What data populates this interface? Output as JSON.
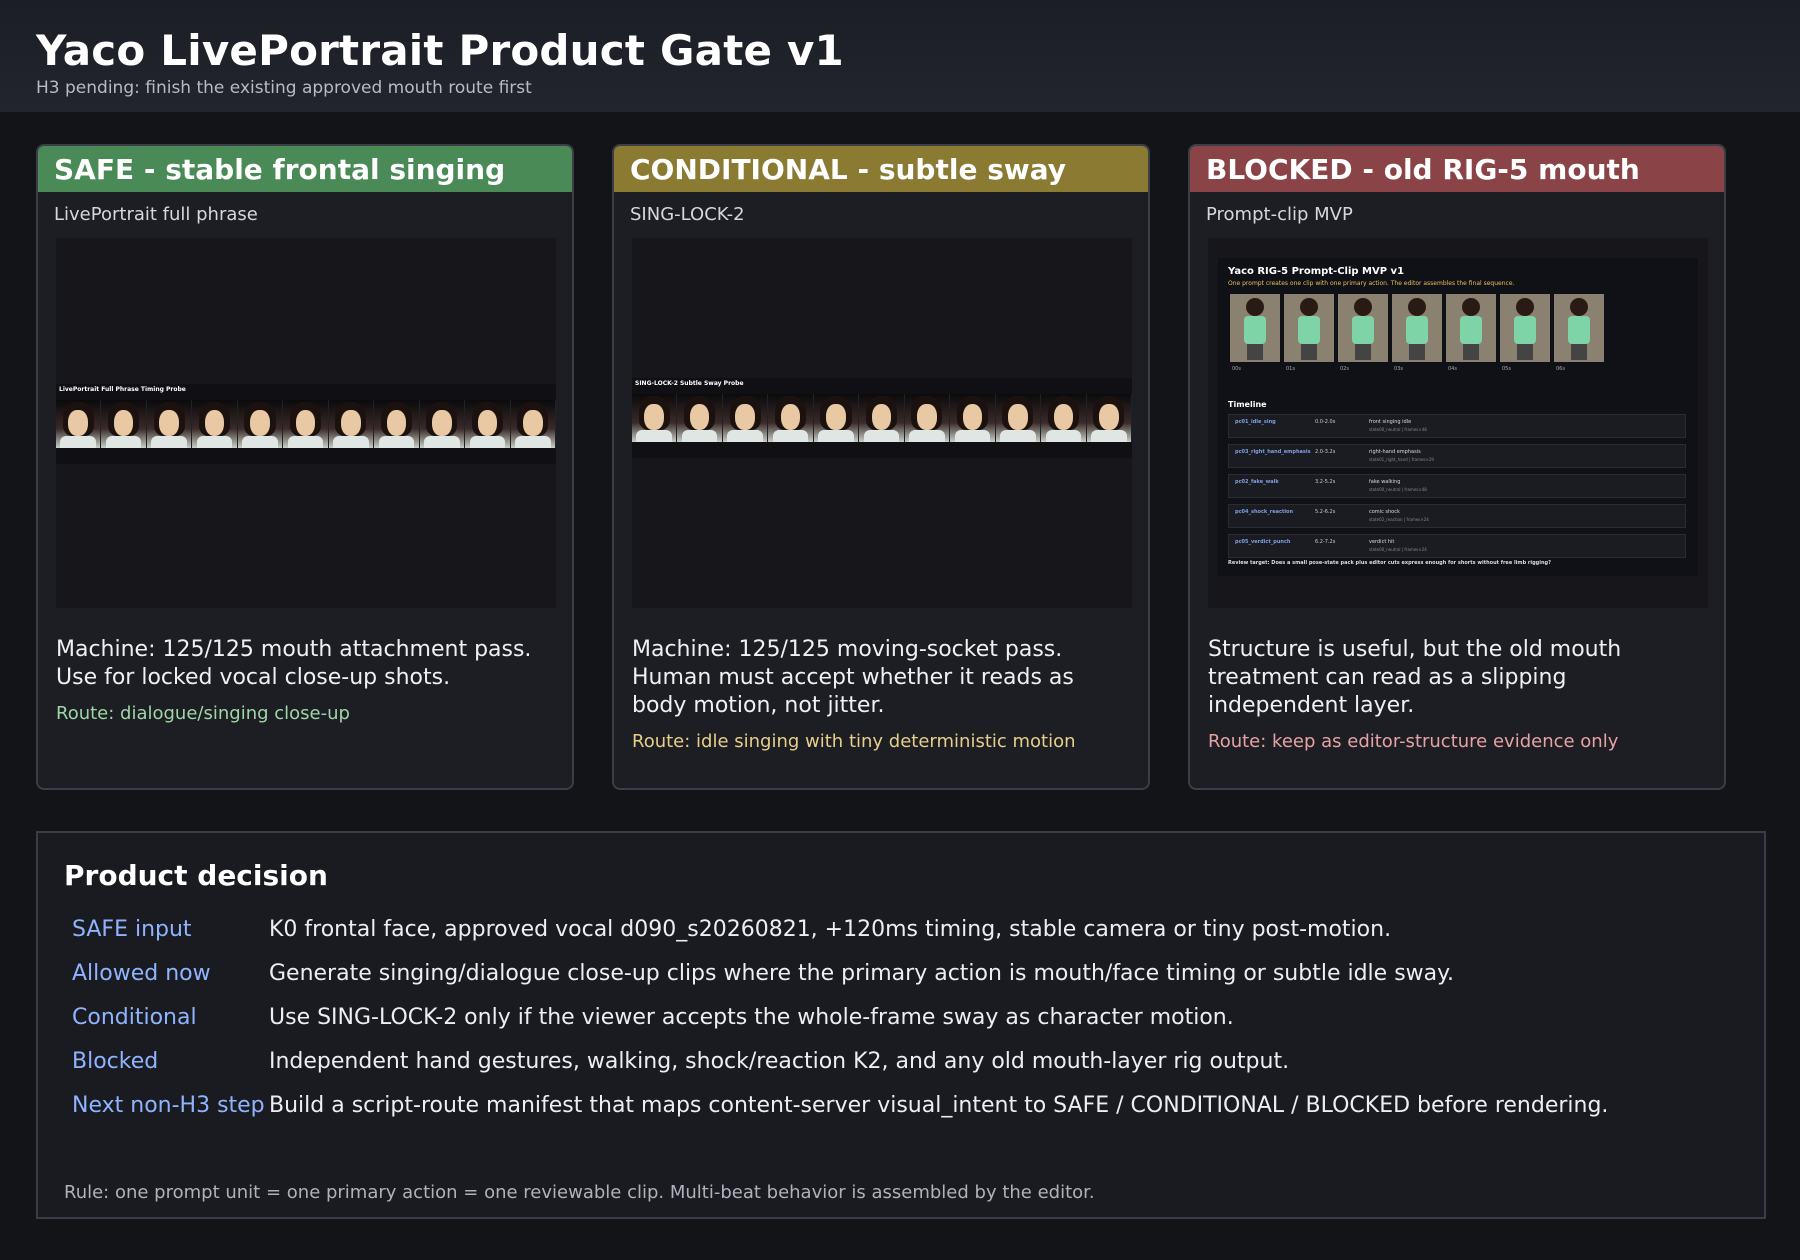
{
  "header": {
    "title": "Yaco LivePortrait Product Gate v1",
    "subtitle": "H3 pending: finish the existing approved mouth route first"
  },
  "cards": [
    {
      "banner": "SAFE - stable frontal singing",
      "banner_color": "#4a8a57",
      "label": "LivePortrait full phrase",
      "thumb_title": "LivePortrait Full Phrase Timing Probe",
      "desc": "Machine: 125/125 mouth attachment pass. Use for locked vocal close-up shots.",
      "route": "Route: dialogue/singing close-up",
      "route_color": "#9fd6a8"
    },
    {
      "banner": "CONDITIONAL - subtle sway",
      "banner_color": "#8a7a32",
      "label": "SING-LOCK-2",
      "thumb_title": "SING-LOCK-2 Subtle Sway Probe",
      "desc": "Machine: 125/125 moving-socket pass. Human must accept whether it reads as body motion, not jitter.",
      "route": "Route: idle singing with tiny deterministic motion",
      "route_color": "#e6cf8a"
    },
    {
      "banner": "BLOCKED - old RIG-5 mouth",
      "banner_color": "#8a4447",
      "label": "Prompt-clip MVP",
      "thumb_title": "Yaco RIG-5 Prompt-Clip MVP v1",
      "thumb_sub": "One prompt creates one clip with one primary action. The editor assembles the final sequence.",
      "thumb_timeline": "Timeline",
      "thumb_frames": [
        "00s",
        "01s",
        "02s",
        "03s",
        "04s",
        "05s",
        "06s"
      ],
      "thumb_rows": [
        {
          "id": "pc01_idle_sing",
          "t": "0.0-2.0s",
          "name": "front singing idle",
          "meta": "state00_neutral | frames×48"
        },
        {
          "id": "pc03_right_hand_emphasis",
          "t": "2.0-3.2s",
          "name": "right-hand emphasis",
          "meta": "state01_right_hand | frames×29"
        },
        {
          "id": "pc02_fake_walk",
          "t": "3.2-5.2s",
          "name": "fake walking",
          "meta": "state00_neutral | frames×48"
        },
        {
          "id": "pc04_shock_reaction",
          "t": "5.2-6.2s",
          "name": "comic shock",
          "meta": "state02_reaction | frames×24"
        },
        {
          "id": "pc05_verdict_punch",
          "t": "6.2-7.2s",
          "name": "verdict hit",
          "meta": "state00_neutral | frames×24"
        }
      ],
      "thumb_review": "Review target: Does a small pose-state pack plus editor cuts express enough for shorts without free limb rigging?",
      "desc": "Structure is useful, but the old mouth treatment can read as a slipping independent layer.",
      "route": "Route: keep as editor-structure evidence only",
      "route_color": "#e7a2a6"
    }
  ],
  "decision": {
    "title": "Product decision",
    "rows": [
      {
        "key": "SAFE input",
        "value": "K0 frontal face, approved vocal d090_s20260821, +120ms timing, stable camera or tiny post-motion."
      },
      {
        "key": "Allowed now",
        "value": "Generate singing/dialogue close-up clips where the primary action is mouth/face timing or subtle idle sway."
      },
      {
        "key": "Conditional",
        "value": "Use SING-LOCK-2 only if the viewer accepts the whole-frame sway as character motion."
      },
      {
        "key": "Blocked",
        "value": "Independent hand gestures, walking, shock/reaction K2, and any old mouth-layer rig output."
      },
      {
        "key": "Next non-H3 step",
        "value": "Build a script-route manifest that maps content-server visual_intent to SAFE / CONDITIONAL / BLOCKED before rendering."
      }
    ],
    "rule": "Rule: one prompt unit = one primary action = one reviewable clip. Multi-beat behavior is assembled by the editor."
  }
}
